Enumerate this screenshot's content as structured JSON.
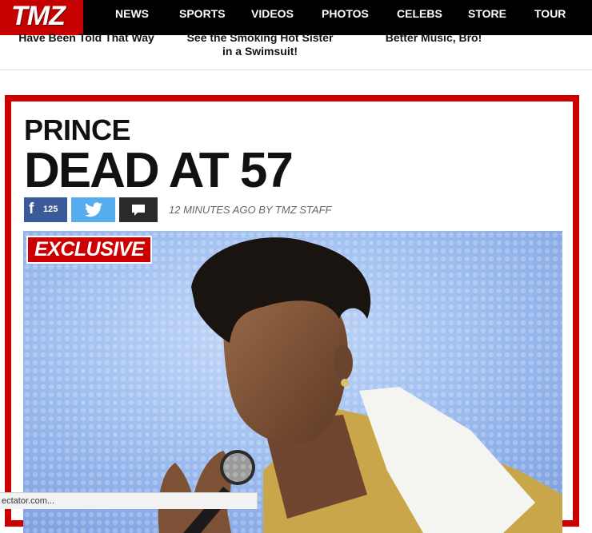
{
  "logo": {
    "text": "TMZ"
  },
  "nav": {
    "items": [
      {
        "label": "NEWS"
      },
      {
        "label": "SPORTS"
      },
      {
        "label": "VIDEOS"
      },
      {
        "label": "PHOTOS"
      },
      {
        "label": "CELEBS"
      },
      {
        "label": "STORE"
      },
      {
        "label": "TOUR"
      }
    ]
  },
  "teasers": [
    {
      "line1": "Have Been Told That Way",
      "line2": ""
    },
    {
      "line1": "See the Smoking Hot Sister",
      "line2": "in a Swimsuit!"
    },
    {
      "line1": "Better Music, Bro!",
      "line2": ""
    }
  ],
  "article": {
    "kicker": "PRINCE",
    "headline": "DEAD AT 57",
    "share": {
      "facebook_icon": "f",
      "facebook_count": "125",
      "twitter_icon": "twitter-bird-icon",
      "comment_icon": "comment-icon"
    },
    "byline": "12 MINUTES AGO BY TMZ STAFF",
    "badge": "EXCLUSIVE",
    "photo_icon": "photo-of-performer-with-microphone"
  },
  "status_bar": {
    "text": "ectator.com..."
  },
  "colors": {
    "brand_red": "#cc0000",
    "nav_bg": "#000000",
    "facebook": "#3b5a9a",
    "twitter": "#55acee",
    "comment": "#2a2a2a"
  }
}
